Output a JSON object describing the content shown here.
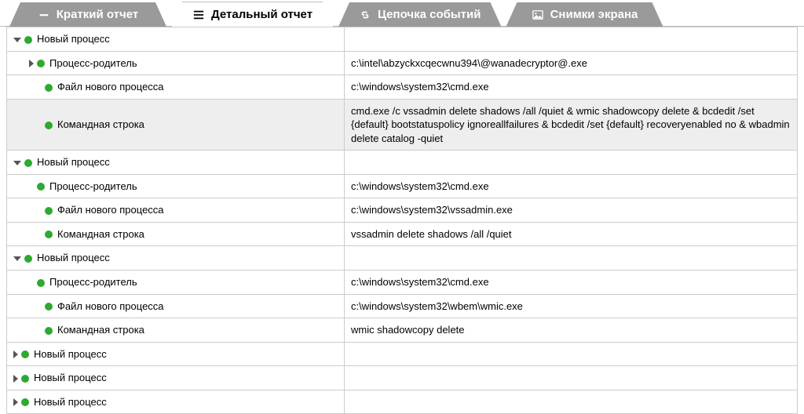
{
  "tabs": {
    "summary": "Краткий отчет",
    "detail": "Детальный отчет",
    "chain": "Цепочка событий",
    "screens": "Снимки экрана"
  },
  "labels": {
    "new_process": "Новый процесс",
    "parent_process": "Процесс-родитель",
    "new_process_file": "Файл нового процесса",
    "command_line": "Командная строка"
  },
  "rows": [
    {
      "kind": "header",
      "expanded": true
    },
    {
      "kind": "parent",
      "expanded": false,
      "value": "c:\\intel\\abzyckxcqecwnu394\\@wanadecryptor@.exe"
    },
    {
      "kind": "file",
      "value": "c:\\windows\\system32\\cmd.exe"
    },
    {
      "kind": "cmd",
      "shaded": true,
      "value": "cmd.exe /c vssadmin delete shadows /all /quiet & wmic shadowcopy delete & bcdedit /set {default} bootstatuspolicy ignoreallfailures & bcdedit /set {default} recoveryenabled no & wbadmin delete catalog -quiet"
    },
    {
      "kind": "header",
      "expanded": true
    },
    {
      "kind": "parent",
      "value": "c:\\windows\\system32\\cmd.exe"
    },
    {
      "kind": "file",
      "value": "c:\\windows\\system32\\vssadmin.exe"
    },
    {
      "kind": "cmd",
      "value": "vssadmin delete shadows /all /quiet"
    },
    {
      "kind": "header",
      "expanded": true
    },
    {
      "kind": "parent",
      "value": "c:\\windows\\system32\\cmd.exe"
    },
    {
      "kind": "file",
      "value": "c:\\windows\\system32\\wbem\\wmic.exe"
    },
    {
      "kind": "cmd",
      "value": "wmic shadowcopy delete"
    },
    {
      "kind": "header",
      "expanded": false
    },
    {
      "kind": "header",
      "expanded": false
    },
    {
      "kind": "header",
      "expanded": false
    }
  ]
}
